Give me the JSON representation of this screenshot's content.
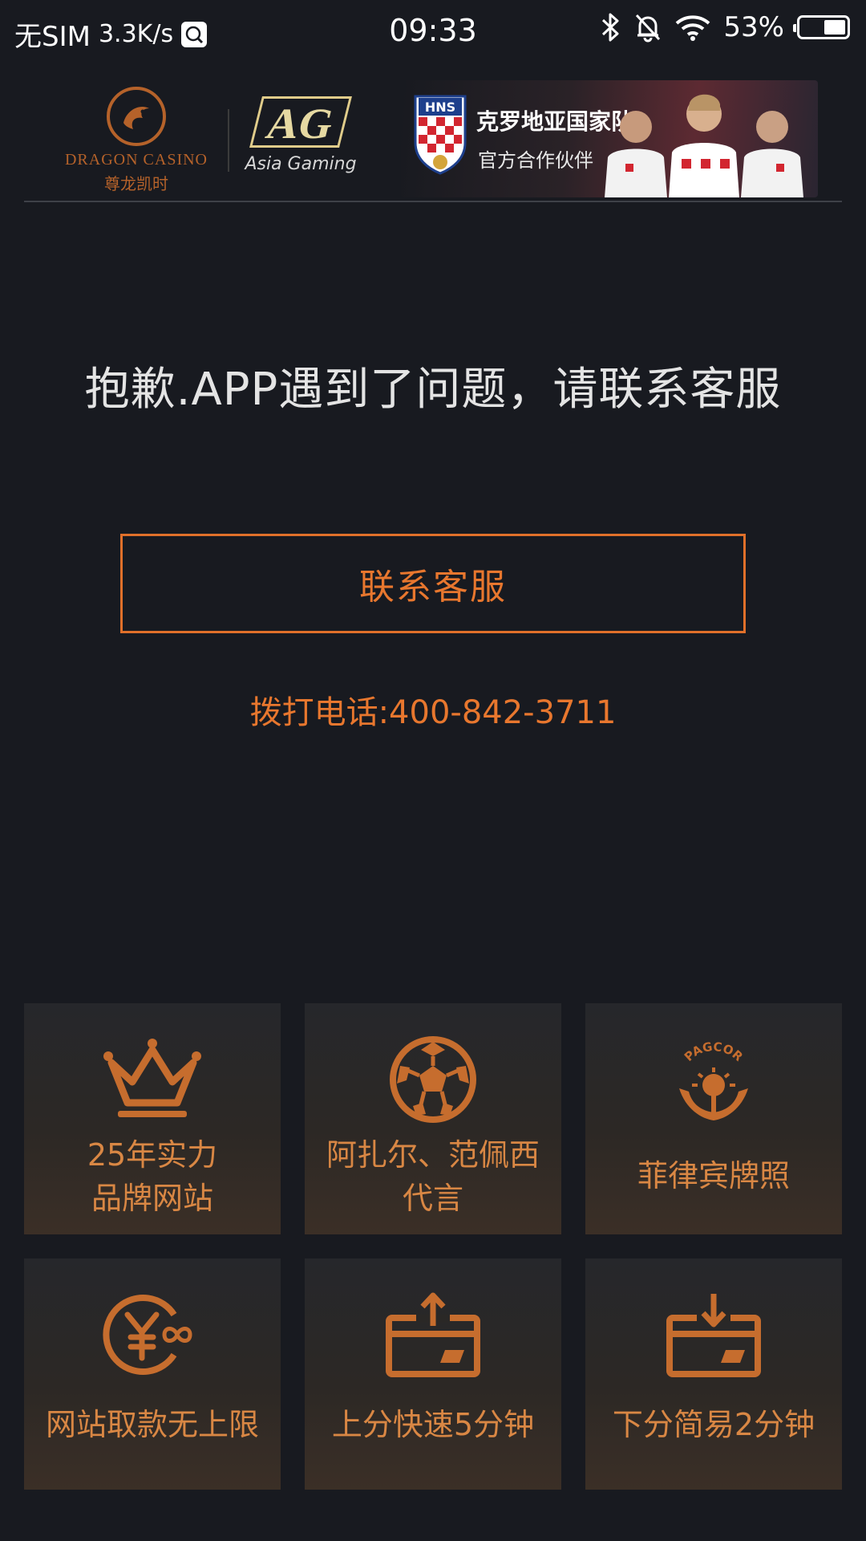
{
  "status_bar": {
    "carrier": "无SIM",
    "speed": "3.3K/s",
    "time": "09:33",
    "battery": "53%",
    "battery_level": 0.53
  },
  "header": {
    "dragon_casino_en": "DRAGON CASINO",
    "dragon_casino_cn": "尊龙凯时",
    "ag_mark": "AG",
    "ag_name": "Asia Gaming",
    "banner_title": "克罗地亚国家队",
    "banner_sub": "官方合作伙伴",
    "hns_badge_text": "HNS"
  },
  "main": {
    "error_message": "抱歉.APP遇到了问题，请联系客服",
    "contact_button": "联系客服",
    "phone": "拨打电话:400-842-3711"
  },
  "features": [
    {
      "icon": "crown-icon",
      "label": "25年实力\n品牌网站"
    },
    {
      "icon": "soccer-ball-icon",
      "label": "阿扎尔、范佩西\n代言"
    },
    {
      "icon": "pagcor-icon",
      "label": "菲律宾牌照",
      "icon_text": "PAGCOR"
    },
    {
      "icon": "yuan-infinity-icon",
      "label": "网站取款无上限"
    },
    {
      "icon": "card-upload-icon",
      "label": "上分快速5分钟"
    },
    {
      "icon": "card-download-icon",
      "label": "下分简易2分钟"
    }
  ],
  "colors": {
    "background": "#181a20",
    "accent": "#e8772e",
    "tile_text": "#d98744"
  }
}
